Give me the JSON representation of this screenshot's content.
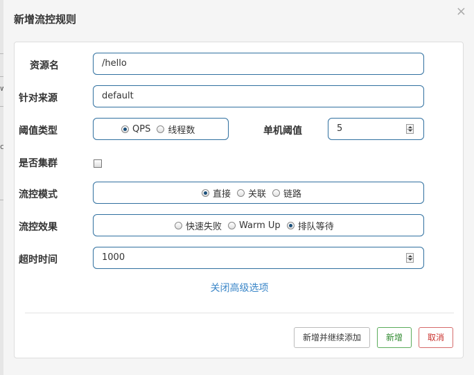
{
  "dialog": {
    "title": "新增流控规则"
  },
  "form": {
    "resource": {
      "label": "资源名",
      "value": "/hello"
    },
    "limit_app": {
      "label": "针对来源",
      "value": "default"
    },
    "grade": {
      "label": "阈值类型",
      "options": [
        "QPS",
        "线程数"
      ],
      "selected": "QPS"
    },
    "threshold": {
      "label": "单机阈值",
      "value": "5"
    },
    "cluster": {
      "label": "是否集群",
      "checked": false
    },
    "strategy": {
      "label": "流控模式",
      "options": [
        "直接",
        "关联",
        "链路"
      ],
      "selected": "直接"
    },
    "control_behavior": {
      "label": "流控效果",
      "options": [
        "快速失败",
        "Warm Up",
        "排队等待"
      ],
      "selected": "排队等待"
    },
    "timeout": {
      "label": "超时时间",
      "value": "1000"
    },
    "advanced_toggle": "关闭高级选项"
  },
  "footer": {
    "add_continue_label": "新增并继续添加",
    "add_label": "新增",
    "cancel_label": "取消"
  },
  "background": {
    "fragments": [
      "w",
      "c"
    ]
  }
}
